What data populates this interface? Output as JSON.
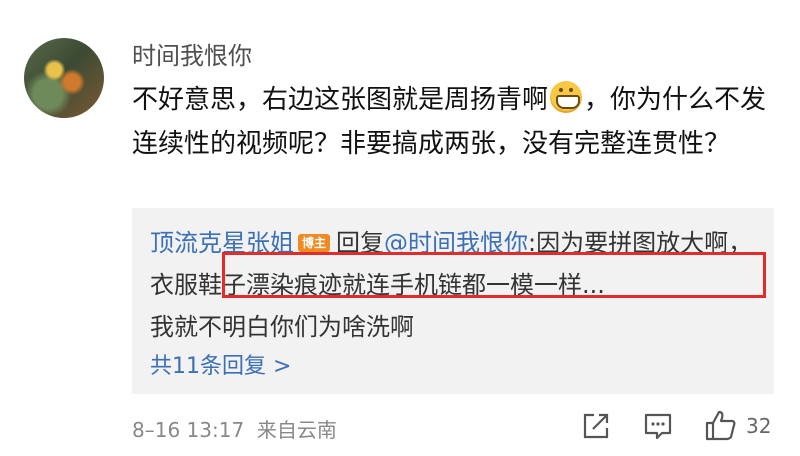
{
  "comment": {
    "username": "时间我恨你",
    "text_before_emoji": "不好意思，右边这张图就是周扬青啊",
    "emoji_name": "grin-emoji",
    "text_after_emoji": "，你为什么不发连续性的视频呢？非要搞成两张，没有完整连贯性？",
    "timestamp": "8–16 13:17",
    "location": "来自云南",
    "like_count": "32"
  },
  "reply": {
    "author": "顶流克星张姐",
    "badge": "博主",
    "action": "回复",
    "mention": "@时间我恨你",
    "text_part1": ":因为要拼图放大啊，",
    "highlighted_text": "衣服鞋子漂染痕迹就连手机链都一模一样...",
    "text_part2": "我就不明白你们为啥洗啊",
    "more_replies": "共11条回复 >"
  },
  "icons": {
    "share": "share-icon",
    "comment": "comment-icon",
    "like": "thumbs-up-icon"
  },
  "colors": {
    "link_blue": "#3b6fb6",
    "badge_orange": "#f08a23",
    "highlight_red": "#e22b2b",
    "reply_bg": "#f2f2f2"
  }
}
